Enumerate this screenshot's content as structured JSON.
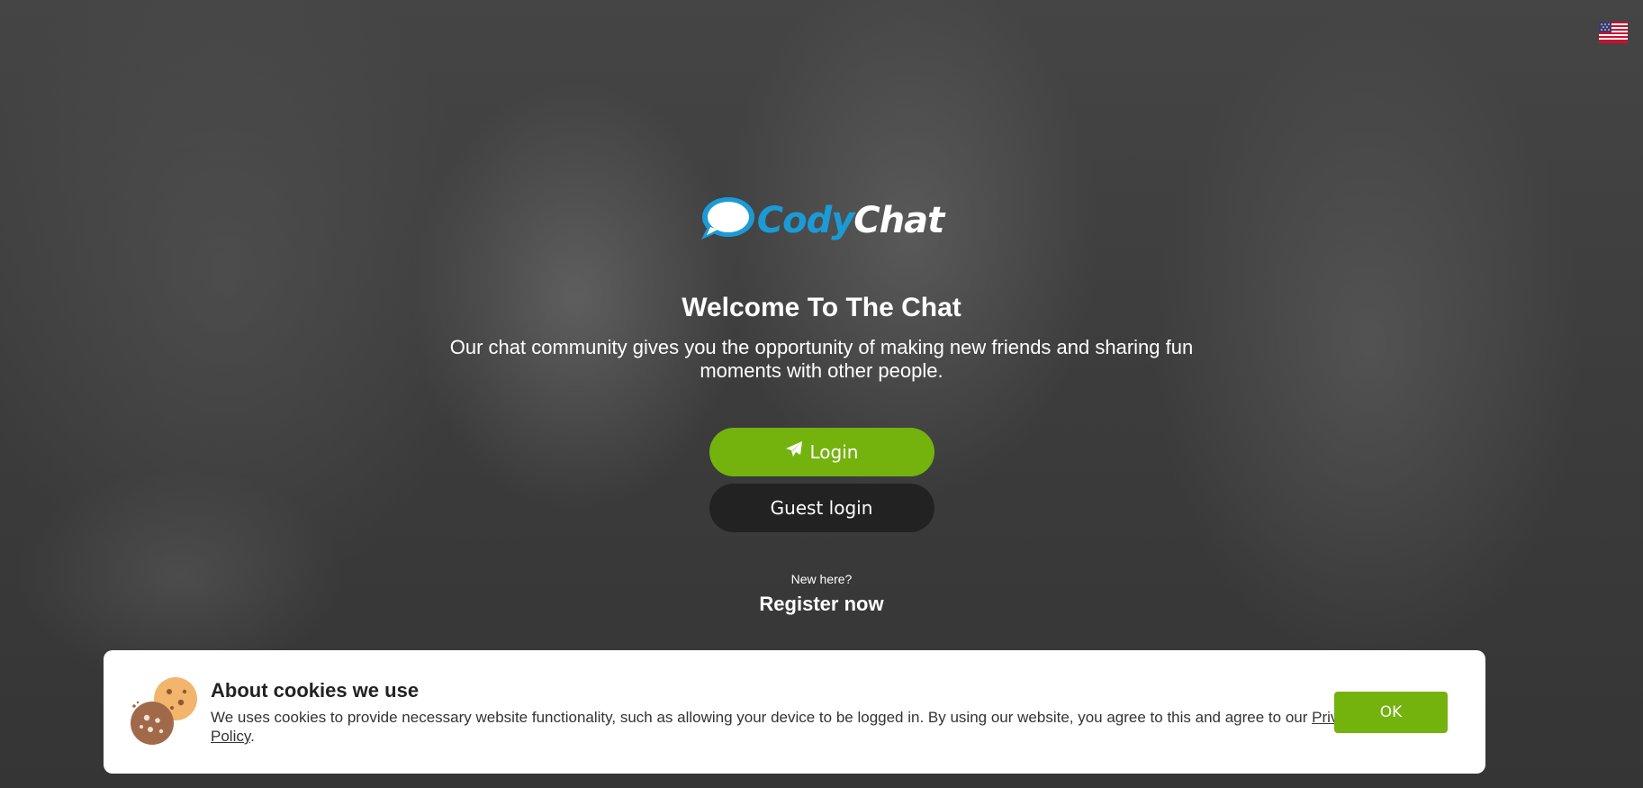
{
  "header": {
    "language_flag_icon": "us-flag-icon"
  },
  "logo": {
    "part1": "Cody",
    "part2": "Chat",
    "icon": "speech-bubble-icon",
    "color_part1": "#1a9bd7"
  },
  "main": {
    "title": "Welcome To The Chat",
    "subtitle": "Our chat community gives you the opportunity of making new friends and sharing fun moments with other people.",
    "login_label": "Login",
    "login_icon": "paper-plane-icon",
    "guest_login_label": "Guest login",
    "new_here_text": "New here?",
    "register_label": "Register now"
  },
  "cookie_banner": {
    "title": "About cookies we use",
    "text_before_link": "We uses cookies to provide necessary website functionality, such as allowing your device to be logged in. By using our website, you agree to this and agree to our ",
    "link_label": "Privacy Policy",
    "text_after_link": ".",
    "ok_label": "OK",
    "icon": "cookie-icon"
  },
  "colors": {
    "accent_green": "#74b20e",
    "guest_button": "#222222",
    "brand_blue": "#1a9bd7"
  }
}
